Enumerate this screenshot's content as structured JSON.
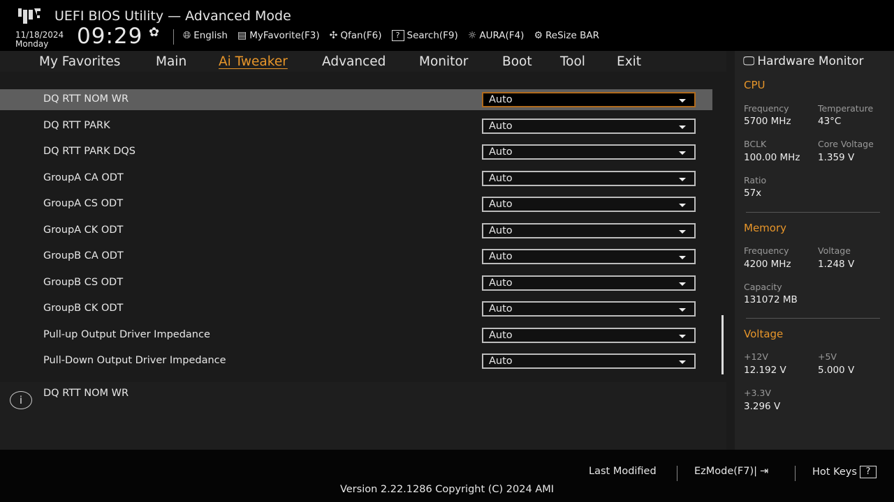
{
  "header": {
    "title": "UEFI BIOS Utility — Advanced Mode",
    "date": "11/18/2024",
    "day": "Monday",
    "time": "09:29",
    "tools": [
      {
        "icon": "globe-icon",
        "glyph": "🌐︎",
        "label": "English"
      },
      {
        "icon": "favorite-list-icon",
        "glyph": "▤",
        "label": "MyFavorite(F3)"
      },
      {
        "icon": "fan-icon",
        "glyph": "✣",
        "label": "Qfan(F6)"
      },
      {
        "icon": "question-box-icon",
        "glyph": "?",
        "label": "Search(F9)"
      },
      {
        "icon": "aura-light-icon",
        "glyph": "☼",
        "label": "AURA(F4)"
      },
      {
        "icon": "resize-bar-icon",
        "glyph": "⚙",
        "label": "ReSize BAR"
      }
    ]
  },
  "tabs": [
    {
      "label": "My Favorites",
      "active": false
    },
    {
      "label": "Main",
      "active": false
    },
    {
      "label": "Ai Tweaker",
      "active": true
    },
    {
      "label": "Advanced",
      "active": false
    },
    {
      "label": "Monitor",
      "active": false
    },
    {
      "label": "Boot",
      "active": false
    },
    {
      "label": "Tool",
      "active": false
    },
    {
      "label": "Exit",
      "active": false
    }
  ],
  "settings": [
    {
      "label": "DQ RTT NOM WR",
      "value": "Auto",
      "selected": true
    },
    {
      "label": "DQ RTT PARK",
      "value": "Auto"
    },
    {
      "label": "DQ RTT PARK DQS",
      "value": "Auto"
    },
    {
      "label": "GroupA CA ODT",
      "value": "Auto"
    },
    {
      "label": "GroupA CS ODT",
      "value": "Auto"
    },
    {
      "label": "GroupA CK ODT",
      "value": "Auto"
    },
    {
      "label": "GroupB CA ODT",
      "value": "Auto"
    },
    {
      "label": "GroupB CS ODT",
      "value": "Auto"
    },
    {
      "label": "GroupB CK ODT",
      "value": "Auto"
    },
    {
      "label": "Pull-up Output Driver Impedance",
      "value": "Auto"
    },
    {
      "label": "Pull-Down Output Driver Impedance",
      "value": "Auto"
    }
  ],
  "info": {
    "text": "DQ RTT NOM WR"
  },
  "hw": {
    "title": "Hardware Monitor",
    "cpu": {
      "heading": "CPU",
      "frequency_label": "Frequency",
      "frequency": "5700 MHz",
      "temperature_label": "Temperature",
      "temperature": "43°C",
      "bclk_label": "BCLK",
      "bclk": "100.00 MHz",
      "core_voltage_label": "Core Voltage",
      "core_voltage": "1.359 V",
      "ratio_label": "Ratio",
      "ratio": "57x"
    },
    "memory": {
      "heading": "Memory",
      "frequency_label": "Frequency",
      "frequency": "4200 MHz",
      "voltage_label": "Voltage",
      "voltage": "1.248 V",
      "capacity_label": "Capacity",
      "capacity": "131072 MB"
    },
    "voltage": {
      "heading": "Voltage",
      "v12_label": "+12V",
      "v12": "12.192 V",
      "v5_label": "+5V",
      "v5": "5.000 V",
      "v33_label": "+3.3V",
      "v33": "3.296 V"
    }
  },
  "footer": {
    "last_modified": "Last Modified",
    "ezmode": "EzMode(F7)|",
    "hotkeys": "Hot Keys",
    "version": "Version 2.22.1286 Copyright (C) 2024 AMI"
  },
  "colors": {
    "accent": "#e8962a",
    "selected_row": "#5e5e5e"
  }
}
